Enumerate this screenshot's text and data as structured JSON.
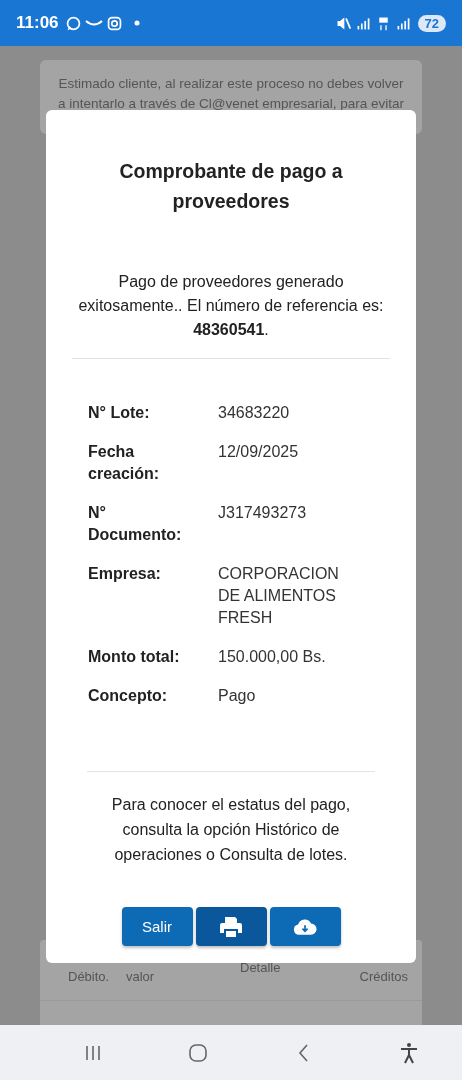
{
  "status_bar": {
    "time": "11:06",
    "battery": "72"
  },
  "background": {
    "notice_lines": [
      "Estimado cliente, al realizar este proceso no debes volver",
      "a intentarlo a través de Cl@venet empresarial, para evitar"
    ],
    "table_columns": [
      {
        "kind": "low",
        "label": "Débito."
      },
      {
        "kind": "low",
        "label": "valor"
      },
      {
        "kind": "high",
        "label": "Detalle"
      },
      {
        "kind": "right",
        "label": "Créditos"
      }
    ]
  },
  "modal": {
    "title": "Comprobante de pago a proveedores",
    "message": "Pago de proveedores generado exitosamente.. El número de referencia es: **48360541**.",
    "details": [
      {
        "label": "N° Lote:",
        "value": "34683220"
      },
      {
        "label": "Fecha creación:",
        "value": "12/09/2025"
      },
      {
        "label": "N° Documento:",
        "value": "J317493273"
      },
      {
        "label": "Empresa:",
        "value": "CORPORACION DE ALIMENTOS FRESH"
      },
      {
        "label": "Monto total:",
        "value": "150.000,00 Bs."
      },
      {
        "label": "Concepto:",
        "value": "Pago"
      }
    ],
    "footer": "Para conocer el estatus del pago, consulta la opción Histórico de operaciones o Consulta de lotes.",
    "buttons": [
      {
        "kind": "text",
        "label": "Salir",
        "focused": false
      },
      {
        "kind": "print",
        "focused": true
      },
      {
        "kind": "download",
        "focused": false
      }
    ]
  }
}
